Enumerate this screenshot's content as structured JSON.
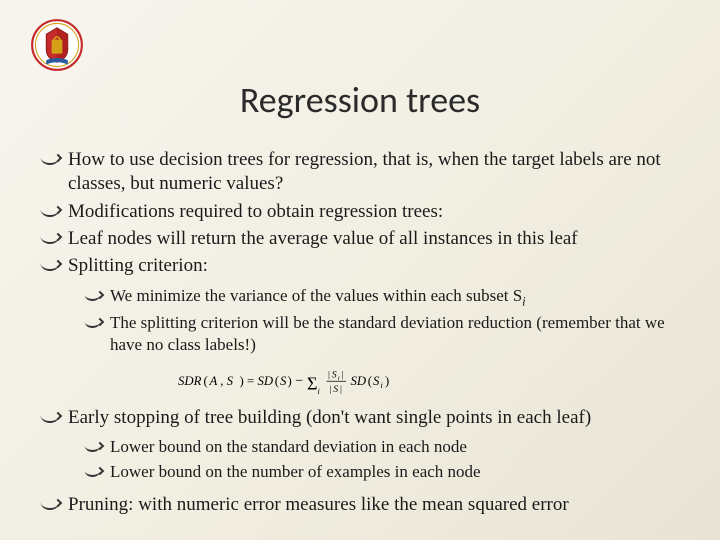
{
  "title": "Regression trees",
  "bullets": [
    {
      "text": "How to use decision trees for regression, that is, when the target labels are not classes, but numeric values?"
    },
    {
      "text": "Modifications required to obtain regression trees:"
    },
    {
      "text": "Leaf nodes will return the average value of all instances in this leaf"
    },
    {
      "text": "Splitting criterion:",
      "children": [
        {
          "text_html": "We minimize the variance of the values within each subset S<i class='sub'>i</i>"
        },
        {
          "text": "The splitting criterion will be the standard deviation reduction (remember that we have no class labels!)"
        }
      ],
      "formula": true
    },
    {
      "text": "Early stopping of tree building (don't want single points in each leaf)",
      "children": [
        {
          "text": "Lower bound on the standard deviation in each node"
        },
        {
          "text": "Lower bound on the number of examples in each node"
        }
      ]
    },
    {
      "text": "Pruning: with numeric error measures like the mean squared error"
    }
  ],
  "formula_label": "SDR(A, S) = SD(S) − Σᵢ (|Sᵢ|/|S|) SD(Sᵢ)"
}
